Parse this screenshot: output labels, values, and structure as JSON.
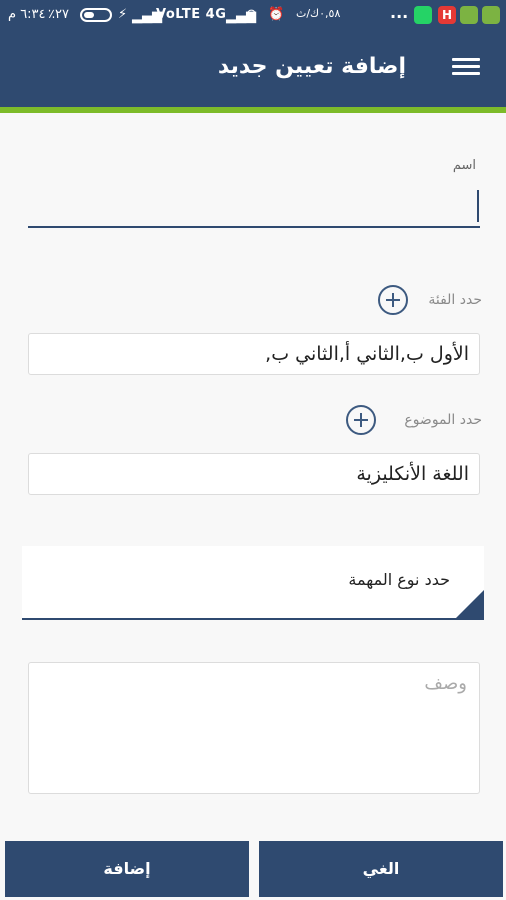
{
  "status_bar": {
    "time": "٦:٣٤ م",
    "battery_percent": "٪٢٧",
    "battery_level": 0.27,
    "network": "VoLTE 4G",
    "speed": "٠,٥٨ك/ث",
    "bolt": "⚡",
    "nosim": "⊘",
    "alarm": "⏰",
    "signal": "▂▄▆",
    "overflow": "...",
    "notif_h": "H"
  },
  "header": {
    "title": "إضافة تعيين جديد",
    "menu_icon": "hamburger-menu-icon",
    "color": "#2f4a70",
    "accent": "#7dbb2a"
  },
  "form": {
    "name_label": "اسم",
    "name_value": "",
    "category_label": "حدد الفئة",
    "category_value": "الأول ب,الثاني أ,الثاني ب,",
    "topic_label": "حدد الموضوع",
    "topic_value": "اللغة الأنكليزية",
    "task_type_label": "حدد نوع المهمة",
    "description_placeholder": "وصف"
  },
  "buttons": {
    "add": "إضافة",
    "cancel": "الغي"
  }
}
